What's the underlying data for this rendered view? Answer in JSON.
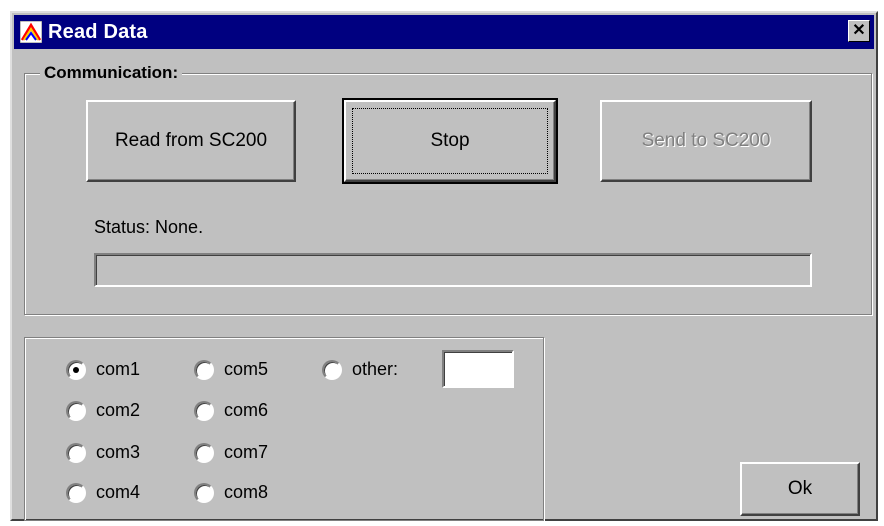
{
  "window": {
    "title": "Read Data",
    "title_bar_color": "#000080",
    "app_icon": "chart-peak-icon",
    "close_icon": "close-icon",
    "close_label": "✕"
  },
  "communication": {
    "group_label": "Communication:",
    "buttons": {
      "read": "Read from SC200",
      "stop": "Stop",
      "send": "Send to SC200"
    },
    "send_enabled": false,
    "status_text": "Status: None.",
    "progress_percent": 0
  },
  "ports": {
    "selected": "com1",
    "options": [
      {
        "label": "com1",
        "checked": true
      },
      {
        "label": "com2",
        "checked": false
      },
      {
        "label": "com3",
        "checked": false
      },
      {
        "label": "com4",
        "checked": false
      },
      {
        "label": "com5",
        "checked": false
      },
      {
        "label": "com6",
        "checked": false
      },
      {
        "label": "com7",
        "checked": false
      },
      {
        "label": "com8",
        "checked": false
      },
      {
        "label": "other:",
        "checked": false
      }
    ],
    "other_value": ""
  },
  "ok_label": "Ok"
}
